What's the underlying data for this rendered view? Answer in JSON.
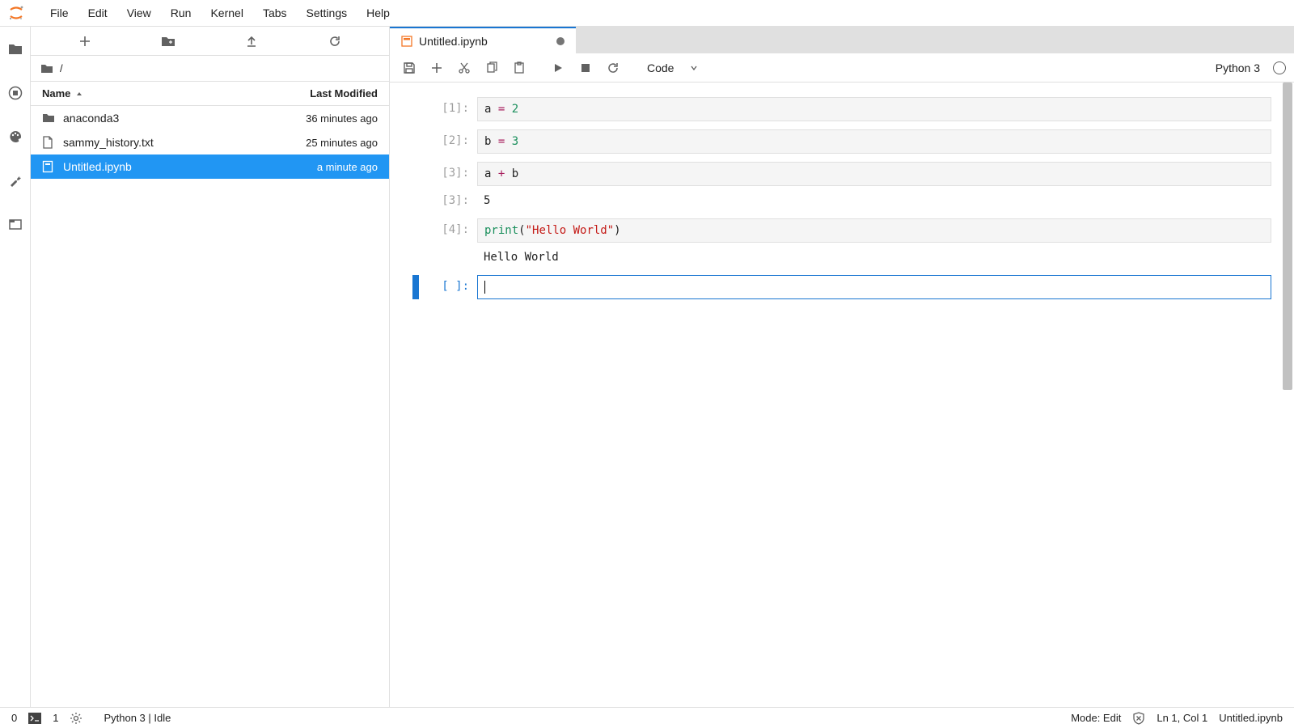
{
  "menu": {
    "items": [
      "File",
      "Edit",
      "View",
      "Run",
      "Kernel",
      "Tabs",
      "Settings",
      "Help"
    ]
  },
  "sidebar": {
    "breadcrumb_path": "/",
    "header_name": "Name",
    "header_modified": "Last Modified",
    "files": [
      {
        "name": "anaconda3",
        "modified": "36 minutes ago",
        "type": "folder",
        "selected": false
      },
      {
        "name": "sammy_history.txt",
        "modified": "25 minutes ago",
        "type": "file",
        "selected": false
      },
      {
        "name": "Untitled.ipynb",
        "modified": "a minute ago",
        "type": "notebook",
        "selected": true
      }
    ]
  },
  "tab": {
    "title": "Untitled.ipynb",
    "dirty": true
  },
  "toolbar": {
    "cell_type": "Code",
    "kernel_name": "Python 3"
  },
  "cells": [
    {
      "prompt": "[1]:",
      "source_tokens": [
        [
          "v",
          "a"
        ],
        [
          "p",
          " "
        ],
        [
          "op",
          "="
        ],
        [
          "p",
          " "
        ],
        [
          "n",
          "2"
        ]
      ]
    },
    {
      "prompt": "[2]:",
      "source_tokens": [
        [
          "v",
          "b"
        ],
        [
          "p",
          " "
        ],
        [
          "op",
          "="
        ],
        [
          "p",
          " "
        ],
        [
          "n",
          "3"
        ]
      ]
    },
    {
      "prompt": "[3]:",
      "source_tokens": [
        [
          "v",
          "a"
        ],
        [
          "p",
          " "
        ],
        [
          "op",
          "+"
        ],
        [
          "p",
          " "
        ],
        [
          "v",
          "b"
        ]
      ],
      "output_prompt": "[3]:",
      "output": "5"
    },
    {
      "prompt": "[4]:",
      "source_tokens": [
        [
          "fn",
          "print"
        ],
        [
          "p",
          "("
        ],
        [
          "s",
          "\"Hello World\""
        ],
        [
          "p",
          ")"
        ]
      ],
      "output_prompt": "",
      "output": "Hello World"
    },
    {
      "prompt": "[ ]:",
      "source_tokens": [],
      "active": true
    }
  ],
  "statusbar": {
    "left_count0": "0",
    "left_count1": "1",
    "kernel_status": "Python 3 | Idle",
    "mode": "Mode: Edit",
    "cursor": "Ln 1, Col 1",
    "filename": "Untitled.ipynb"
  }
}
